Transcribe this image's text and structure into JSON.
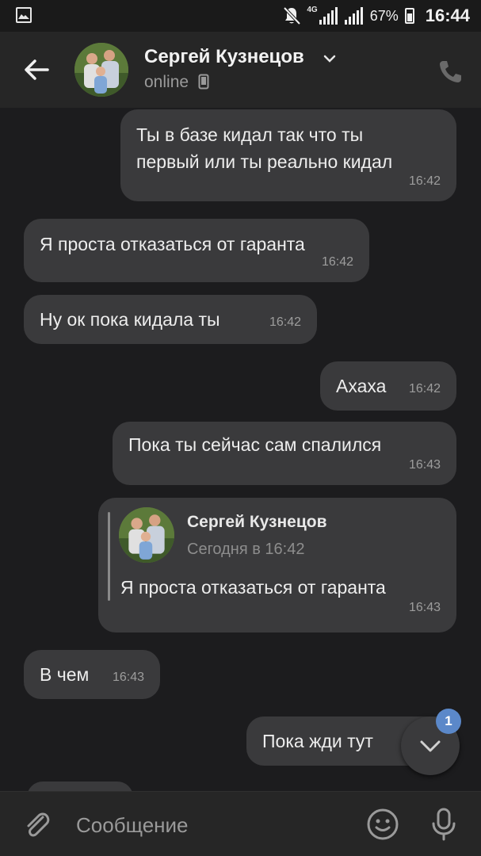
{
  "status_bar": {
    "network": "4G",
    "battery_percent": "67%",
    "time": "16:44",
    "icons": [
      "image-icon",
      "bell-off-icon",
      "signal-icon",
      "signal-icon",
      "battery-icon"
    ]
  },
  "header": {
    "contact_name": "Сергей Кузнецов",
    "status": "online",
    "icons": [
      "back-arrow-icon",
      "chevron-down-icon",
      "mobile-device-icon",
      "phone-icon"
    ]
  },
  "messages": [
    {
      "direction": "out",
      "lines": [
        "Ты в базе кидал так что ты",
        "первый или ты реально кидал"
      ],
      "time": "16:42"
    },
    {
      "direction": "in",
      "lines": [
        "Я проста отказаться от гаранта"
      ],
      "time": "16:42"
    },
    {
      "direction": "in",
      "lines": [
        "Ну ок пока кидала ты"
      ],
      "time": "16:42"
    },
    {
      "direction": "out",
      "lines": [
        "Ахаха"
      ],
      "time": "16:42"
    },
    {
      "direction": "out",
      "lines": [
        "Пока ты сейчас сам спалился"
      ],
      "time": "16:43"
    },
    {
      "direction": "out",
      "reply": {
        "author": "Сергей Кузнецов",
        "date": "Сегодня в 16:42",
        "text": "Я проста отказаться от гаранта"
      },
      "time": "16:43"
    },
    {
      "direction": "in",
      "lines": [
        "В чем"
      ],
      "time": "16:43"
    },
    {
      "direction": "out",
      "lines": [
        "Пока жди тут"
      ],
      "time": ""
    }
  ],
  "scroll_down": {
    "badge": "1",
    "icon": "chevron-down-icon"
  },
  "composer": {
    "placeholder": "Сообщение",
    "icons": [
      "paperclip-icon",
      "emoji-icon",
      "microphone-icon"
    ]
  },
  "colors": {
    "background": "#1c1c1e",
    "bar": "#262626",
    "bubble": "#3a3a3c",
    "badge": "#5b88c9",
    "text": "#ededed",
    "muted": "#9d9d9d"
  }
}
